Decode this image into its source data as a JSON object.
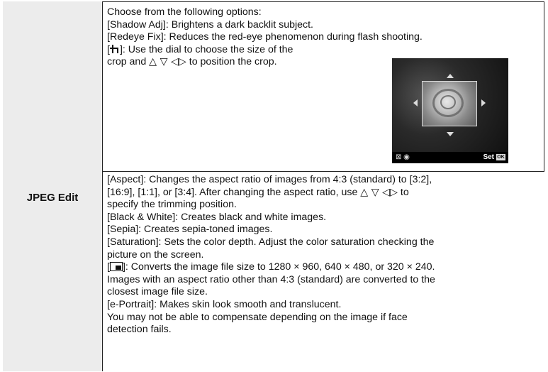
{
  "row_label": "JPEG Edit",
  "cell1": {
    "line1": "Choose from the following options:",
    "line2": "[Shadow Adj]: Brightens a dark backlit subject.",
    "line3": "[Redeye Fix]: Reduces the red-eye phenomenon during flash shooting.",
    "crop_prefix": "[",
    "crop_suffix": "]: Use the dial to choose the size of the",
    "crop_line2a": "crop and ",
    "arrows": "△ ▽ ◁▷",
    "crop_line2b": " to position the crop.",
    "preview": {
      "bottom_left_icons": "⊠ ◉",
      "set_label": "Set",
      "ok_label": "OK"
    }
  },
  "cell2": {
    "aspect1": "[Aspect]: Changes the aspect ratio of images from 4:3 (standard) to [3:2],",
    "aspect2a": "[16:9], [1:1], or [3:4]. After changing the aspect ratio, use ",
    "aspect_arrows": "△ ▽ ◁▷",
    "aspect2b": " to",
    "aspect3": "specify the trimming position.",
    "bw": "[Black & White]: Creates black and white images.",
    "sepia": "[Sepia]: Creates sepia-toned images.",
    "sat1": "[Saturation]: Sets the color depth. Adjust the color saturation checking the",
    "sat2": "picture on the screen.",
    "resize_prefix": "[",
    "resize_suffix": "]: Converts the image file size to 1280 × 960, 640 × 480, or 320 × 240.",
    "resize2": "Images with an aspect ratio other than 4:3 (standard) are converted to the",
    "resize3": "closest image file size.",
    "eportrait": "[e-Portrait]: Makes skin look smooth and translucent.",
    "face1": "You may not be able to compensate depending on the image if face",
    "face2": "detection fails."
  }
}
